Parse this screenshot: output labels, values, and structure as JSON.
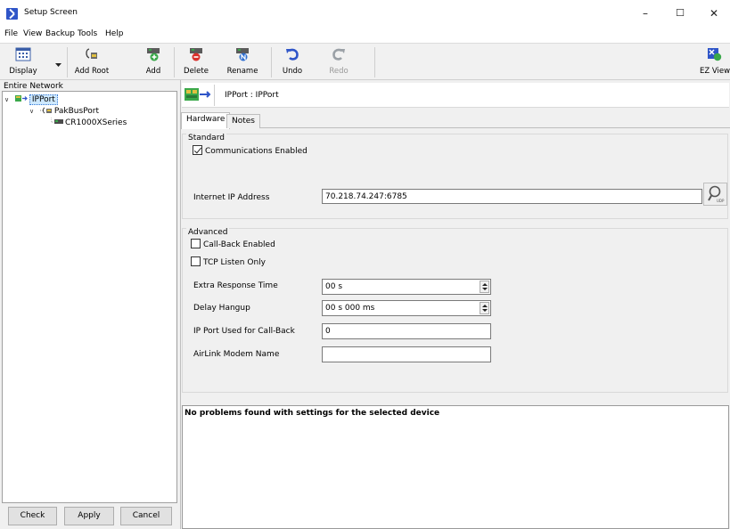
{
  "window": {
    "title": "Setup Screen",
    "minimize_glyph": "–",
    "maximize_glyph": "☐",
    "close_glyph": "✕"
  },
  "menu": [
    "File",
    "View",
    "Backup",
    "Tools",
    "Help"
  ],
  "toolbar": {
    "display": "Display",
    "add_root": "Add Root",
    "add": "Add",
    "delete": "Delete",
    "rename": "Rename",
    "undo": "Undo",
    "redo": "Redo",
    "ez_view": "EZ View"
  },
  "network": {
    "header": "Entire Network",
    "tree": [
      {
        "label": "IPPort",
        "level": 0,
        "icon": "ipport-icon",
        "selected": true
      },
      {
        "label": "PakBusPort",
        "level": 1,
        "icon": "pakbus-port-icon",
        "selected": false
      },
      {
        "label": "CR1000XSeries",
        "level": 2,
        "icon": "datalogger-icon",
        "selected": false
      }
    ],
    "check_button": "Check",
    "apply_button": "Apply",
    "cancel_button": "Cancel"
  },
  "device": {
    "title": "IPPort : IPPort",
    "icon": "ipport-device-icon"
  },
  "tabs": [
    "Hardware",
    "Notes"
  ],
  "standard": {
    "title": "Standard",
    "communications_enabled_label": "Communications Enabled",
    "communications_enabled": true,
    "ip_address_label": "Internet IP Address",
    "ip_address_value": "70.218.74.247:6785"
  },
  "advanced": {
    "title": "Advanced",
    "callback_enabled_label": "Call-Back Enabled",
    "callback_enabled": false,
    "tcp_listen_label": "TCP Listen Only",
    "tcp_listen": false,
    "extra_response_label": "Extra Response Time",
    "extra_response_value": "00 s",
    "delay_hangup_label": "Delay Hangup",
    "delay_hangup_value": "00 s 000 ms",
    "ip_port_callback_label": "IP Port Used for Call-Back",
    "ip_port_callback_value": "0",
    "airlink_label": "AirLink Modem Name",
    "airlink_value": ""
  },
  "status": {
    "message": "No problems found with settings for the selected device"
  },
  "colors": {
    "selection": "#cde8ff",
    "accent_blue": "#2f55c8",
    "device_green": "#3aa84a"
  }
}
